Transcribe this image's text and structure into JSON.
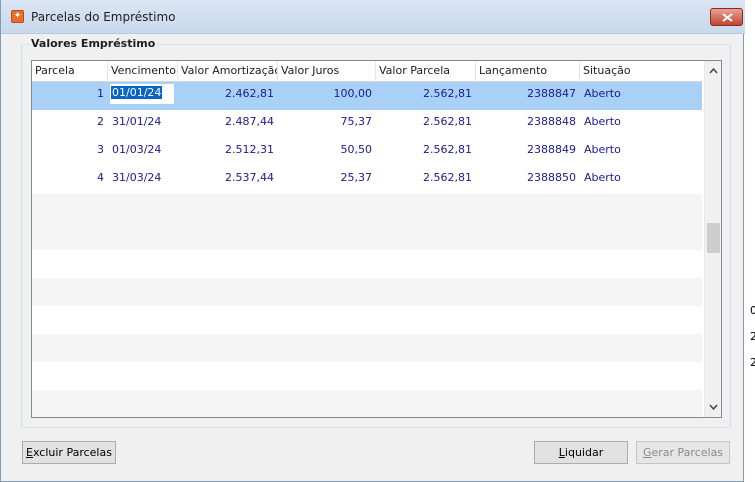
{
  "window": {
    "title": "Parcelas do Empréstimo"
  },
  "group": {
    "label": "Valores Empréstimo"
  },
  "table": {
    "columns": [
      "Parcela",
      "Vencimento",
      "Valor Amortização",
      "Valor Juros",
      "Valor Parcela",
      "Lançamento",
      "Situação"
    ],
    "rows": [
      {
        "parcela": "1",
        "vencimento": "01/01/24",
        "amortizacao": "2.462,81",
        "juros": "100,00",
        "parcela_valor": "2.562,81",
        "lancamento": "2388847",
        "situacao": "Aberto"
      },
      {
        "parcela": "2",
        "vencimento": "31/01/24",
        "amortizacao": "2.487,44",
        "juros": "75,37",
        "parcela_valor": "2.562,81",
        "lancamento": "2388848",
        "situacao": "Aberto"
      },
      {
        "parcela": "3",
        "vencimento": "01/03/24",
        "amortizacao": "2.512,31",
        "juros": "50,50",
        "parcela_valor": "2.562,81",
        "lancamento": "2388849",
        "situacao": "Aberto"
      },
      {
        "parcela": "4",
        "vencimento": "31/03/24",
        "amortizacao": "2.537,44",
        "juros": "25,37",
        "parcela_valor": "2.562,81",
        "lancamento": "2388850",
        "situacao": "Aberto"
      }
    ],
    "selected_row": 1
  },
  "buttons": {
    "excluir_first": "E",
    "excluir_rest": "xcluir Parcelas",
    "liquidar_first": "L",
    "liquidar_rest": "iquidar",
    "gerar_first": "G",
    "gerar_rest": "erar Parcelas"
  },
  "background_glyphs": [
    "0",
    "2",
    "2"
  ],
  "colors": {
    "selection": "#a9d1f7",
    "cell_text": "#1b1b8f",
    "close_button": "#c24632"
  }
}
